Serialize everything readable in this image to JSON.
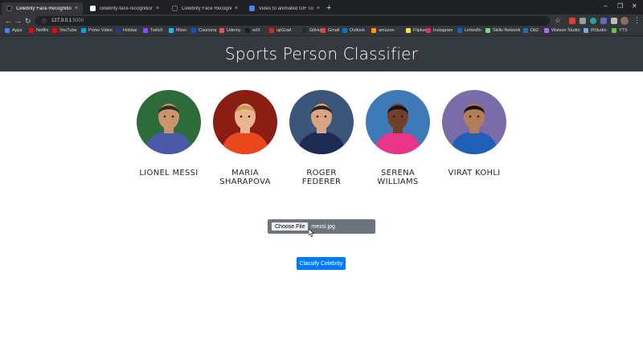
{
  "tabs": [
    {
      "title": "Celebrity Face Recognition",
      "favicon_color": "#202124",
      "active": true
    },
    {
      "title": "celebrity-face-recognition · GitH",
      "favicon_color": "#ffffff",
      "active": false
    },
    {
      "title": "Celebrity Face Recognition",
      "favicon_color": "#202124",
      "active": false
    },
    {
      "title": "Video to animated GIF converter",
      "favicon_color": "#4285f4",
      "active": false
    }
  ],
  "new_tab_label": "+",
  "window_controls": {
    "minimize": "–",
    "maximize": "❐",
    "close": "✕"
  },
  "tab_close": "×",
  "address": {
    "info_icon": "ⓘ",
    "host": "127.0.0.1",
    "port": ":5000"
  },
  "nav": {
    "back": "←",
    "forward": "→",
    "reload": "↻",
    "star": "☆",
    "menu": "⋮"
  },
  "bookmarks": [
    {
      "label": "Apps",
      "color": "#4285f4"
    },
    {
      "label": "Netflix",
      "color": "#e50914"
    },
    {
      "label": "YouTube",
      "color": "#ff0000"
    },
    {
      "label": "Prime Video",
      "color": "#00a8e1"
    },
    {
      "label": "Hotstar",
      "color": "#1f3a93"
    },
    {
      "label": "Twitch",
      "color": "#9146ff"
    },
    {
      "label": "Mixer",
      "color": "#1fbaed"
    },
    {
      "label": "Coursera",
      "color": "#0056d2"
    },
    {
      "label": "Udemy",
      "color": "#ec5252"
    },
    {
      "label": "edX",
      "color": "#02262b"
    },
    {
      "label": "upGrad",
      "color": "#e2231a"
    },
    {
      "label": "GitHub",
      "color": "#24292e"
    },
    {
      "label": "Gmail",
      "color": "#ea4335"
    },
    {
      "label": "Outlook",
      "color": "#0078d4"
    },
    {
      "label": "amazon",
      "color": "#ff9900"
    },
    {
      "label": "Flipkart",
      "color": "#f8e831"
    },
    {
      "label": "Instagram",
      "color": "#e1306c"
    },
    {
      "label": "LinkedIn",
      "color": "#0a66c2"
    },
    {
      "label": "Skills Network",
      "color": "#6fdc8c"
    },
    {
      "label": "Db2",
      "color": "#1f70c1"
    },
    {
      "label": "Watson Studio",
      "color": "#a56eff"
    },
    {
      "label": "RStudio",
      "color": "#75aadb"
    },
    {
      "label": "YTS",
      "color": "#6ac045"
    }
  ],
  "page": {
    "title": "Sports Person Classifier",
    "celebrities": [
      {
        "name": "LIONEL MESSI",
        "skin": "#c9956d",
        "shirt": "#4a5aa8",
        "bg": "#2e6b3a",
        "hair": "#3a2a1e"
      },
      {
        "name": "MARIA SHARAPOVA",
        "skin": "#e9b48e",
        "shirt": "#e8481c",
        "bg": "#8a1d14",
        "hair": "#c79a52"
      },
      {
        "name": "ROGER FEDERER",
        "skin": "#d7a583",
        "shirt": "#1d2b52",
        "bg": "#3c567a",
        "hair": "#2b211b"
      },
      {
        "name": "SERENA WILLIAMS",
        "skin": "#6e4128",
        "shirt": "#e8348a",
        "bg": "#3f7ab8",
        "hair": "#1a1210"
      },
      {
        "name": "VIRAT KOHLI",
        "skin": "#b57c59",
        "shirt": "#1f5fb5",
        "bg": "#7a6ca8",
        "hair": "#1b1410"
      }
    ],
    "file_button": "Choose File",
    "file_name": "messi.jpg",
    "classify_button": "Classify Celebrity",
    "colors": {
      "header": "#343a40",
      "primary": "#007bff",
      "file_bg": "#6c757d"
    }
  }
}
